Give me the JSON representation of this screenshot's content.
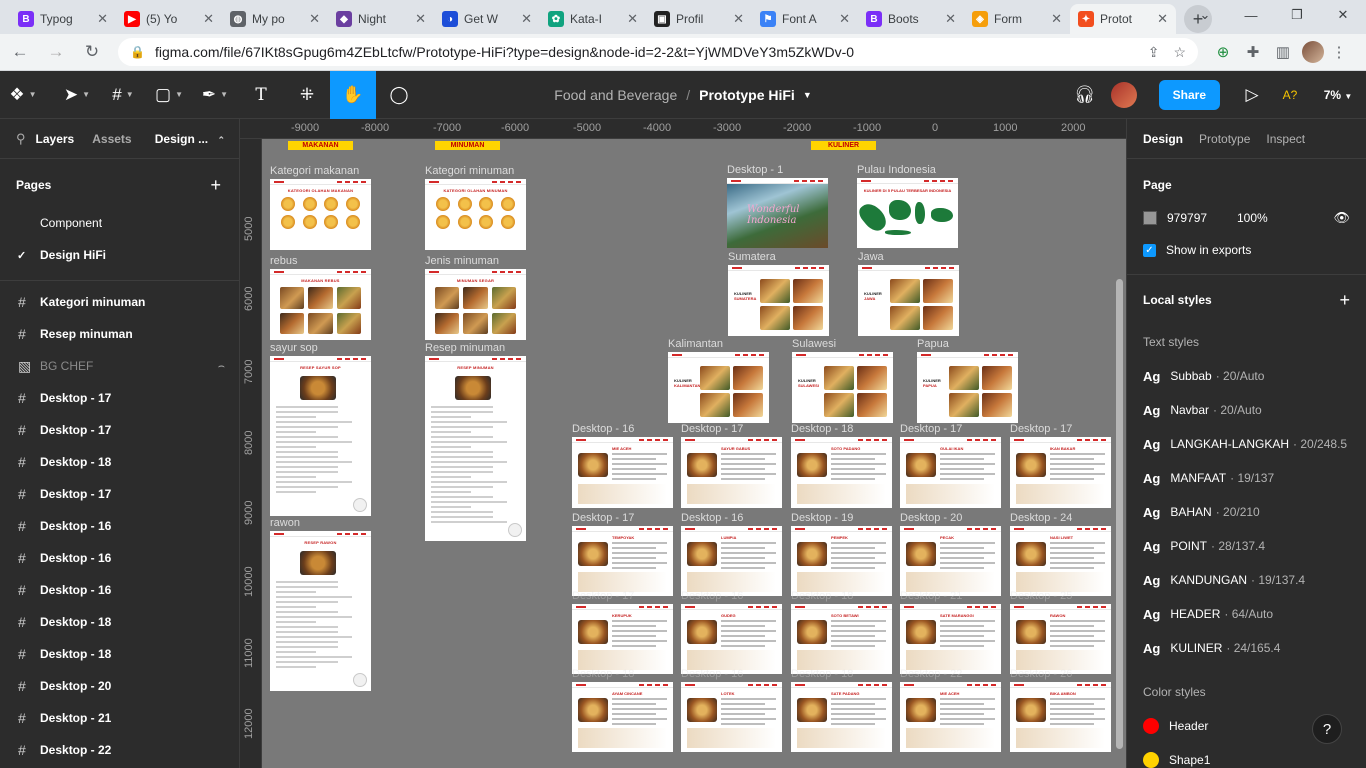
{
  "browser": {
    "tabs": [
      {
        "title": "Typog",
        "color": "#7b2ff7",
        "glyph": "B"
      },
      {
        "title": "(5) Yo",
        "color": "#ff0000",
        "glyph": "▶"
      },
      {
        "title": "My po",
        "color": "#5f6368",
        "glyph": "◍"
      },
      {
        "title": "Night",
        "color": "#6b3fa0",
        "glyph": "◆"
      },
      {
        "title": "Get W",
        "color": "#1d4ed8",
        "glyph": "◑"
      },
      {
        "title": "Kata-I",
        "color": "#10a37f",
        "glyph": "✿"
      },
      {
        "title": "Profil",
        "color": "#222222",
        "glyph": "▣"
      },
      {
        "title": "Font A",
        "color": "#3b82f6",
        "glyph": "⚑"
      },
      {
        "title": "Boots",
        "color": "#7b2ff7",
        "glyph": "B"
      },
      {
        "title": "Form",
        "color": "#f59e0b",
        "glyph": "◈"
      },
      {
        "title": "Protot",
        "color": "#f24e1e",
        "glyph": "✦"
      }
    ],
    "url": "figma.com/file/67IKt8sGpug6m4ZEbLtcfw/Prototype-HiFi?type=design&node-id=2-2&t=YjWMDVeY3m5ZkWDv-0"
  },
  "figma": {
    "project": "Food and Beverage",
    "doc_title": "Prototype HiFi",
    "share_label": "Share",
    "aq_label": "A?",
    "zoom": "7%",
    "left_tabs": {
      "layers": "Layers",
      "assets": "Assets",
      "page": "Design ..."
    },
    "pages_header": "Pages",
    "pages": [
      {
        "name": "Component",
        "current": false
      },
      {
        "name": "Design HiFi",
        "current": true
      }
    ],
    "layers": [
      {
        "name": "Kategori minuman",
        "dim": false
      },
      {
        "name": "Resep minuman",
        "dim": false
      },
      {
        "name": "BG CHEF",
        "dim": true
      },
      {
        "name": "Desktop - 17",
        "dim": false
      },
      {
        "name": "Desktop - 17",
        "dim": false
      },
      {
        "name": "Desktop - 18",
        "dim": false
      },
      {
        "name": "Desktop - 17",
        "dim": false
      },
      {
        "name": "Desktop - 16",
        "dim": false
      },
      {
        "name": "Desktop - 16",
        "dim": false
      },
      {
        "name": "Desktop - 16",
        "dim": false
      },
      {
        "name": "Desktop - 18",
        "dim": false
      },
      {
        "name": "Desktop - 18",
        "dim": false
      },
      {
        "name": "Desktop - 20",
        "dim": false
      },
      {
        "name": "Desktop - 21",
        "dim": false
      },
      {
        "name": "Desktop - 22",
        "dim": false
      }
    ],
    "right_tabs": {
      "design": "Design",
      "prototype": "Prototype",
      "inspect": "Inspect"
    },
    "page_section": {
      "title": "Page",
      "color_hex": "979797",
      "opacity": "100%",
      "show_in_exports": "Show in exports"
    },
    "local_styles": "Local styles",
    "text_styles_label": "Text styles",
    "text_styles": [
      {
        "ag": "Ag",
        "name": "Subbab",
        "meta": "· 20/Auto"
      },
      {
        "ag": "Ag",
        "name": "Navbar",
        "meta": "· 20/Auto"
      },
      {
        "ag": "Ag",
        "name": "LANGKAH-LANGKAH",
        "meta": "· 20/248.5"
      },
      {
        "ag": "Ag",
        "name": "MANFAAT",
        "meta": "· 19/137"
      },
      {
        "ag": "Ag",
        "name": "BAHAN",
        "meta": "· 20/210"
      },
      {
        "ag": "Ag",
        "name": "POINT",
        "meta": "· 28/137.4"
      },
      {
        "ag": "Ag",
        "name": "KANDUNGAN",
        "meta": "· 19/137.4"
      },
      {
        "ag": "Ag",
        "name": "HEADER",
        "meta": "· 64/Auto"
      },
      {
        "ag": "Ag",
        "name": "KULINER",
        "meta": "· 24/165.4"
      }
    ],
    "color_styles_label": "Color styles",
    "color_styles": [
      {
        "name": "Header",
        "color": "#ff0000"
      },
      {
        "name": "Shape1",
        "color": "#ffd200"
      }
    ],
    "help": "?"
  },
  "rulers": {
    "top": [
      "-9000",
      "-8000",
      "-7000",
      "-6000",
      "-5000",
      "-4000",
      "-3000",
      "-2000",
      "-1000",
      "0",
      "1000",
      "2000"
    ],
    "left": [
      "5000",
      "6000",
      "7000",
      "8000",
      "9000",
      "10000",
      "11000",
      "12000"
    ]
  },
  "canvas": {
    "sections": {
      "makanan": "MAKANAN",
      "minuman": "MINUMAN",
      "kuliner": "KULINER"
    },
    "frame_labels": {
      "kat_makanan": "Kategori makanan",
      "kat_minuman": "Kategori minuman",
      "rebus": "rebus",
      "jenis_minuman": "Jenis minuman",
      "sayur_sop": "sayur sop",
      "resep_minuman": "Resep minuman",
      "rawon": "rawon",
      "desktop1": "Desktop - 1",
      "pulau": "Pulau Indonesia",
      "sumatera": "Sumatera",
      "jawa": "Jawa",
      "kalimantan": "Kalimantan",
      "sulawesi": "Sulawesi",
      "papua": "Papua"
    },
    "frame_titles": {
      "kat_makanan": "KATEGORI OLAHAN MAKANAN",
      "kat_minuman": "KATEGORI OLAHAN MINUMAN",
      "rebus": "MAKANAN REBUS",
      "jenis_minuman": "MINUMAN SEGAR",
      "sayur_sop": "RESEP SAYUR SOP",
      "resep_minuman": "RESEP MINUMAN",
      "rawon": "RESEP RAWON",
      "pulau": "KULINER DI 5 PULAU TERBESAR INDONESIA",
      "hero": "Wonderful Indonesia"
    },
    "region_labels": {
      "sumatera": [
        "KULINER",
        "SUMATERA"
      ],
      "jawa": [
        "KULINER",
        "JAWA"
      ],
      "kalimantan": [
        "KULINER",
        "KALIMANTAN"
      ],
      "sulawesi": [
        "KULINER",
        "SULAWESI"
      ],
      "papua": [
        "KULINER",
        "PAPUA"
      ]
    },
    "desktop_grid": [
      [
        {
          "label": "Desktop - 16",
          "title": "MIE ACEH"
        },
        {
          "label": "Desktop - 17",
          "title": "SAYUR GABUS"
        },
        {
          "label": "Desktop - 18",
          "title": "SOTO PADANG"
        },
        {
          "label": "Desktop - 17",
          "title": "GULAI IKAN"
        },
        {
          "label": "Desktop - 17",
          "title": "IKAN BAKAR"
        }
      ],
      [
        {
          "label": "Desktop - 17",
          "title": "TEMPOYAK"
        },
        {
          "label": "Desktop - 16",
          "title": "LUMPIA"
        },
        {
          "label": "Desktop - 19",
          "title": "PEMPEK"
        },
        {
          "label": "Desktop - 20",
          "title": "PECAK"
        },
        {
          "label": "Desktop - 24",
          "title": "NASI LIWET"
        }
      ],
      [
        {
          "label": "Desktop - 17",
          "title": "KERUPUK"
        },
        {
          "label": "Desktop - 16",
          "title": "GUDEG"
        },
        {
          "label": "Desktop - 18",
          "title": "SOTO BETAWI"
        },
        {
          "label": "Desktop - 21",
          "title": "SATE MARANGGI"
        },
        {
          "label": "Desktop - 25",
          "title": "RAWON"
        }
      ],
      [
        {
          "label": "Desktop - 18",
          "title": "AYAM CINCANE"
        },
        {
          "label": "Desktop - 16",
          "title": "LOTEK"
        },
        {
          "label": "Desktop - 18",
          "title": "SATE PADANG"
        },
        {
          "label": "Desktop - 22",
          "title": "MIE ACEH"
        },
        {
          "label": "Desktop - 26",
          "title": "BIKA AMBON"
        }
      ]
    ]
  }
}
